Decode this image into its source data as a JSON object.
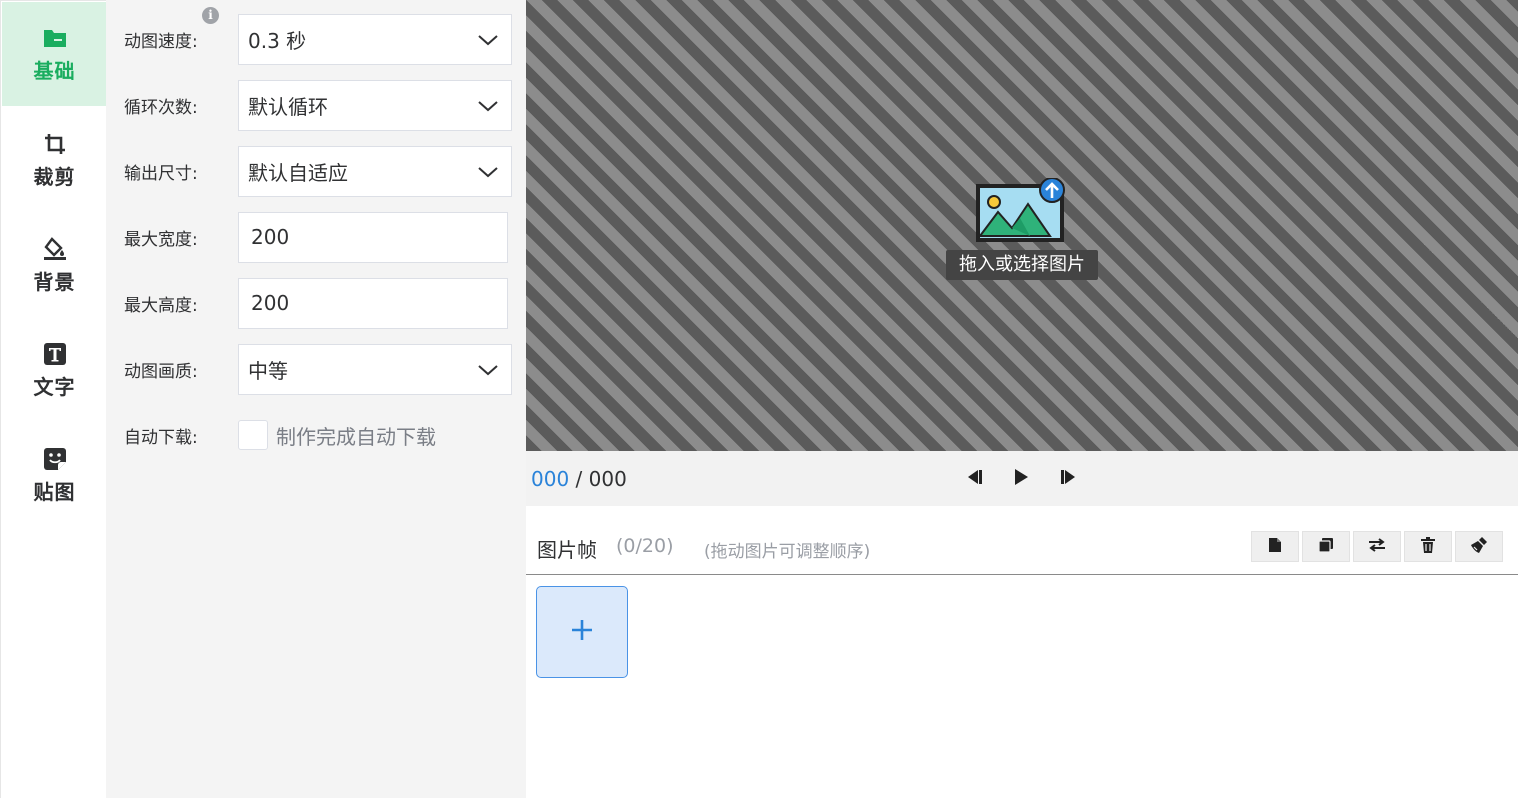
{
  "nav": {
    "items": [
      {
        "id": "basic",
        "label": "基础",
        "icon": "folder-icon",
        "active": true
      },
      {
        "id": "crop",
        "label": "裁剪",
        "icon": "crop-icon",
        "active": false
      },
      {
        "id": "background",
        "label": "背景",
        "icon": "paint-bucket-icon",
        "active": false
      },
      {
        "id": "text",
        "label": "文字",
        "icon": "text-box-icon",
        "active": false
      },
      {
        "id": "sticker",
        "label": "贴图",
        "icon": "sticker-icon",
        "active": false
      }
    ]
  },
  "settings": {
    "speed": {
      "label": "动图速度:",
      "value": "0.3 秒"
    },
    "loop": {
      "label": "循环次数:",
      "value": "默认循环"
    },
    "size": {
      "label": "输出尺寸:",
      "value": "默认自适应"
    },
    "max_width": {
      "label": "最大宽度:",
      "value": "200"
    },
    "max_height": {
      "label": "最大高度:",
      "value": "200"
    },
    "quality": {
      "label": "动图画质:",
      "value": "中等"
    },
    "auto_download": {
      "label": "自动下载:",
      "checkbox_label": "制作完成自动下载",
      "checked": false
    }
  },
  "canvas": {
    "drop_hint": "拖入或选择图片"
  },
  "player": {
    "current": "000",
    "separator": "/",
    "total": "000"
  },
  "frames": {
    "title": "图片帧",
    "count": "(0/20)",
    "tip": "(拖动图片可调整顺序)",
    "add_symbol": "+"
  },
  "colors": {
    "accent_green": "#1aad5f",
    "accent_blue": "#2a83d9",
    "active_nav_bg": "#d9f2e3"
  }
}
